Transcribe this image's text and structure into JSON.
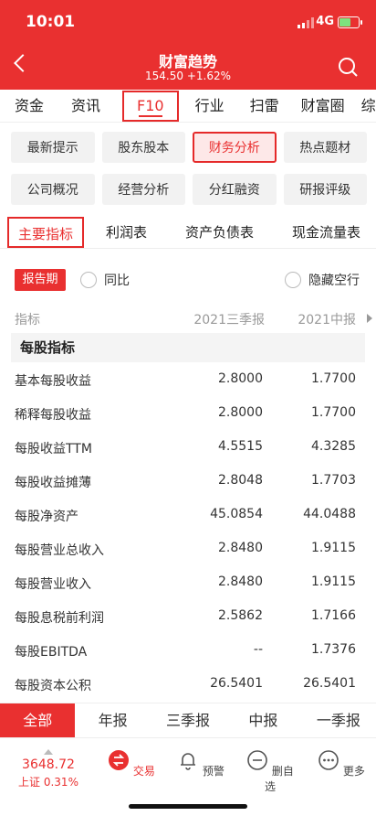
{
  "status": {
    "time": "10:01",
    "network": "4G"
  },
  "header": {
    "title": "财富趋势",
    "price": "154.50",
    "change": "+1.62%"
  },
  "top_tabs": [
    "资金",
    "资讯",
    "F10",
    "行业",
    "扫雷",
    "财富圈",
    "综"
  ],
  "grid": [
    "最新提示",
    "股东股本",
    "财务分析",
    "热点题材",
    "公司概况",
    "经营分析",
    "分红融资",
    "研报评级"
  ],
  "sub_tabs": [
    "主要指标",
    "利润表",
    "资产负债表",
    "现金流量表"
  ],
  "filters": {
    "period_label": "报告期",
    "yoy_label": "同比",
    "hide_empty_label": "隐藏空行"
  },
  "table": {
    "headers": [
      "指标",
      "2021三季报",
      "2021中报"
    ],
    "section": "每股指标",
    "rows": [
      {
        "name": "基本每股收益",
        "v1": "2.8000",
        "v2": "1.7700"
      },
      {
        "name": "稀释每股收益",
        "v1": "2.8000",
        "v2": "1.7700"
      },
      {
        "name": "每股收益TTM",
        "v1": "4.5515",
        "v2": "4.3285"
      },
      {
        "name": "每股收益摊薄",
        "v1": "2.8048",
        "v2": "1.7703"
      },
      {
        "name": "每股净资产",
        "v1": "45.0854",
        "v2": "44.0488"
      },
      {
        "name": "每股营业总收入",
        "v1": "2.8480",
        "v2": "1.9115"
      },
      {
        "name": "每股营业收入",
        "v1": "2.8480",
        "v2": "1.9115"
      },
      {
        "name": "每股息税前利润",
        "v1": "2.5862",
        "v2": "1.7166"
      },
      {
        "name": "每股EBITDA",
        "v1": "--",
        "v2": "1.7376"
      },
      {
        "name": "每股资本公积",
        "v1": "26.5401",
        "v2": "26.5401"
      }
    ]
  },
  "period_bar": [
    "全部",
    "年报",
    "三季报",
    "中报",
    "一季报"
  ],
  "bottom": {
    "index_value": "3648.72",
    "index_label": "上证 0.31%",
    "items": [
      "交易",
      "预警",
      "删自选",
      "更多"
    ]
  },
  "colors": {
    "accent": "#e93030",
    "highlight_border": "#e52a2a"
  }
}
